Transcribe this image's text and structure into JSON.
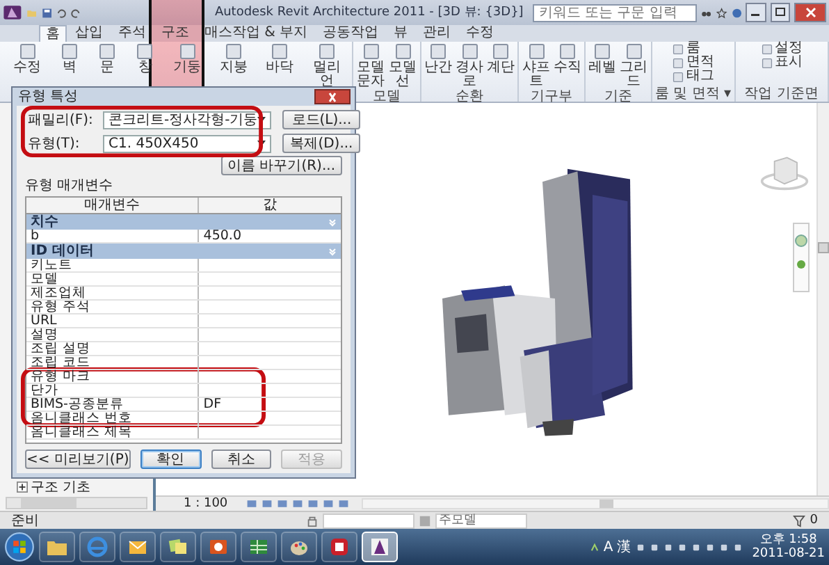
{
  "window": {
    "title": "Autodesk Revit Architecture 2011 - [3D 뷰: {3D}]",
    "search_placeholder": "키워드 또는 구문 입력"
  },
  "ribbon_tabs": [
    {
      "label": "홈",
      "selected": true
    },
    {
      "label": "삽입",
      "selected": false
    },
    {
      "label": "주석",
      "selected": false
    },
    {
      "label": "구조",
      "selected": false
    },
    {
      "label": "매스작업 & 부지",
      "selected": false
    },
    {
      "label": "공동작업",
      "selected": false
    },
    {
      "label": "뷰",
      "selected": false
    },
    {
      "label": "관리",
      "selected": false
    },
    {
      "label": "수정",
      "selected": false
    }
  ],
  "ribbon_panels": [
    {
      "kind": "large",
      "buttons": [
        "수정",
        "벽",
        "문",
        "창",
        "기둥",
        "지붕",
        "바닥",
        "멀리언"
      ]
    },
    {
      "kind": "large",
      "label": "모델",
      "buttons": [
        "모델 문자",
        "모델 선"
      ]
    },
    {
      "kind": "large",
      "label": "순환",
      "buttons": [
        "난간",
        "경사로",
        "계단"
      ]
    },
    {
      "kind": "large",
      "label": "기구부",
      "buttons": [
        "샤프트",
        "수직"
      ]
    },
    {
      "kind": "large",
      "label": "기준",
      "buttons": [
        "레벨",
        "그리드"
      ]
    },
    {
      "kind": "stack",
      "label": "룸 및 면적 ▾",
      "buttons": [
        "룸",
        "면적",
        "태그"
      ]
    },
    {
      "kind": "stack",
      "label": "작업 기준면",
      "buttons": [
        "설정",
        "표시"
      ]
    }
  ],
  "dialog": {
    "title": "유형 특성",
    "family_label": "패밀리(F):",
    "family": "콘크리트-정사각형-기둥",
    "type_label": "유형(T):",
    "type": "C1. 450X450",
    "side_buttons": [
      "로드(L)...",
      "복제(D)...",
      "이름 바꾸기(R)..."
    ],
    "section_label": "유형 매개변수",
    "columns": [
      "매개변수",
      "값"
    ],
    "rows": [
      {
        "kind": "group",
        "name": "치수"
      },
      {
        "kind": "param",
        "name": "b",
        "value": "450.0"
      },
      {
        "kind": "group",
        "name": "ID 데이터"
      },
      {
        "kind": "param",
        "name": "키노트"
      },
      {
        "kind": "param",
        "name": "모델"
      },
      {
        "kind": "param",
        "name": "제조업체"
      },
      {
        "kind": "param",
        "name": "유형 주석"
      },
      {
        "kind": "param",
        "name": "URL"
      },
      {
        "kind": "param",
        "name": "설명"
      },
      {
        "kind": "param",
        "name": "조립 설명"
      },
      {
        "kind": "param",
        "name": "조립 코드"
      },
      {
        "kind": "param",
        "name": "유형 마크"
      },
      {
        "kind": "param",
        "name": "단가"
      },
      {
        "kind": "param",
        "name": "BIMS-공종분류",
        "value": "DF"
      },
      {
        "kind": "param",
        "name": "옴니클래스 번호"
      },
      {
        "kind": "param",
        "name": "옴니클래스 제목"
      }
    ],
    "buttons": [
      {
        "label": "<< 미리보기(P)",
        "disabled": false,
        "default": false
      },
      {
        "label": "확인",
        "disabled": false,
        "default": true
      },
      {
        "label": "취소",
        "disabled": false,
        "default": false
      },
      {
        "label": "적용",
        "disabled": true,
        "default": false
      }
    ]
  },
  "project_browser": {
    "items": [
      {
        "label": "구조 기초",
        "expanded": false
      }
    ]
  },
  "view_bar": {
    "scale": "1 : 100"
  },
  "status_bar": {
    "text": "준비",
    "workset": "주모델",
    "filter_count": "0"
  },
  "taskbar": {
    "apps": [
      {
        "kind": "folder",
        "selected": false
      },
      {
        "kind": "browser",
        "selected": false
      },
      {
        "kind": "mail",
        "selected": false
      },
      {
        "kind": "notes",
        "selected": false
      },
      {
        "kind": "slides",
        "selected": false
      },
      {
        "kind": "sheet",
        "selected": false
      },
      {
        "kind": "paint",
        "selected": false
      },
      {
        "kind": "tool",
        "selected": false
      },
      {
        "kind": "revit",
        "selected": true
      }
    ],
    "ime": [
      "A",
      "漢"
    ],
    "time": "오후 1:58",
    "date": "2011-08-21"
  }
}
